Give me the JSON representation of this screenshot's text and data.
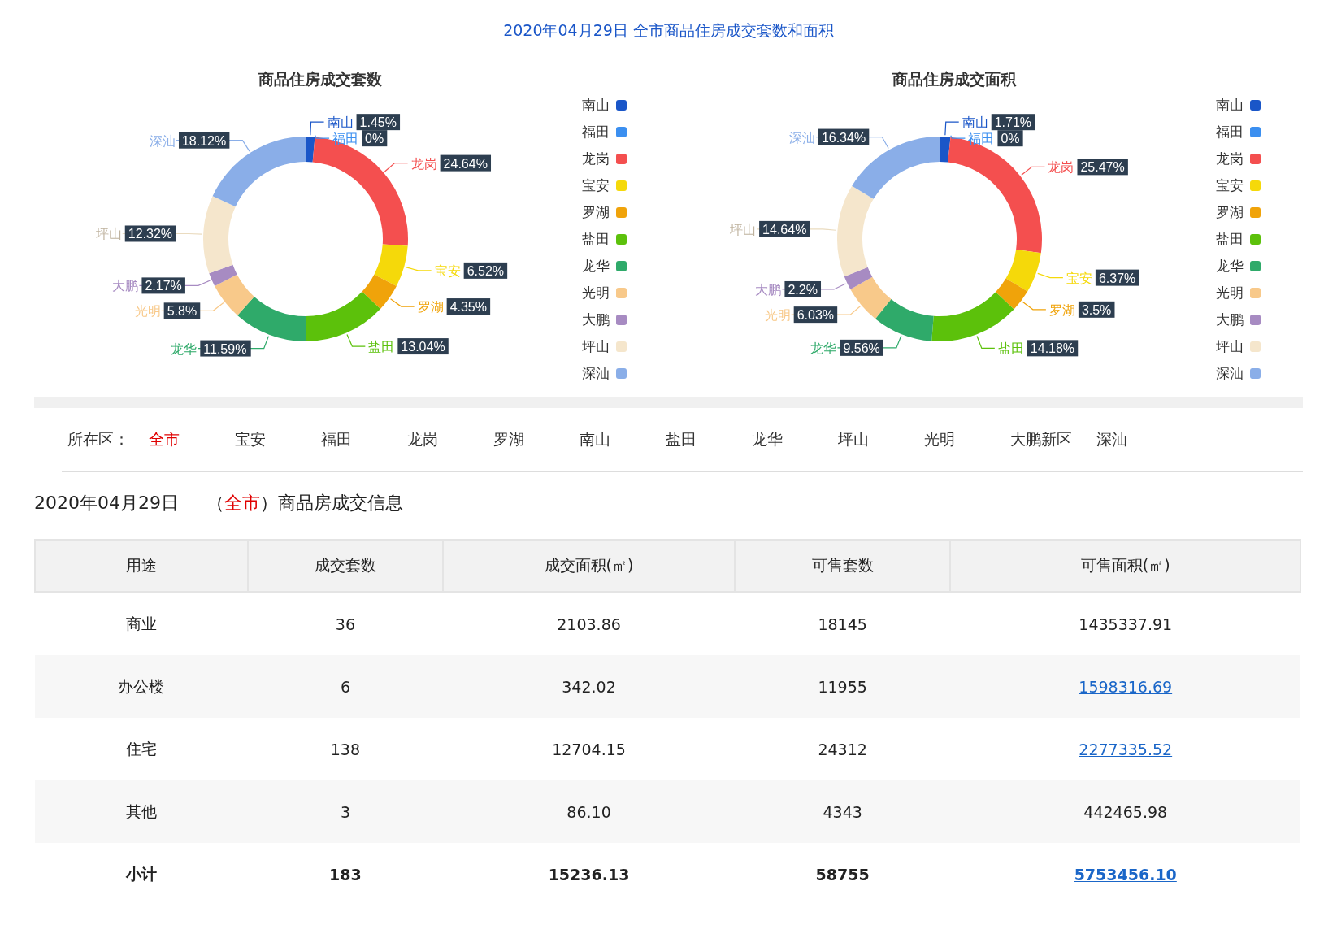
{
  "page_title": "2020年04月29日 全市商品住房成交套数和面积",
  "charts": [
    {
      "chart_data": {
        "type": "donut",
        "title": "商品住房成交套数",
        "categories": [
          "南山",
          "福田",
          "龙岗",
          "宝安",
          "罗湖",
          "盐田",
          "龙华",
          "光明",
          "大鹏",
          "坪山",
          "深汕"
        ],
        "series": [
          {
            "colors": [
              "#1a56c8",
              "#3b8ff0",
              "#f44f4f",
              "#f5d90a",
              "#f0a30a",
              "#5cc10b",
              "#2faa6a",
              "#f8c98a",
              "#a78bc2",
              "#f5e6cc",
              "#8aaee8"
            ],
            "values": [
              1.45,
              0,
              24.64,
              6.52,
              4.35,
              13.04,
              11.59,
              5.8,
              2.17,
              12.32,
              18.12
            ]
          }
        ],
        "value_labels": [
          "1.45%",
          "0%",
          "24.64%",
          "6.52%",
          "4.35%",
          "13.04%",
          "11.59%",
          "5.8%",
          "2.17%",
          "12.32%",
          "18.12%"
        ]
      },
      "legend": [
        "南山",
        "福田",
        "龙岗",
        "宝安",
        "罗湖",
        "盐田",
        "龙华",
        "光明",
        "大鹏",
        "坪山",
        "深汕"
      ]
    },
    {
      "chart_data": {
        "type": "donut",
        "title": "商品住房成交面积",
        "categories": [
          "南山",
          "福田",
          "龙岗",
          "宝安",
          "罗湖",
          "盐田",
          "龙华",
          "光明",
          "大鹏",
          "坪山",
          "深汕"
        ],
        "series": [
          {
            "colors": [
              "#1a56c8",
              "#3b8ff0",
              "#f44f4f",
              "#f5d90a",
              "#f0a30a",
              "#5cc10b",
              "#2faa6a",
              "#f8c98a",
              "#a78bc2",
              "#f5e6cc",
              "#8aaee8"
            ],
            "values": [
              1.71,
              0,
              25.47,
              6.37,
              3.5,
              14.18,
              9.56,
              6.03,
              2.2,
              14.64,
              16.34
            ]
          }
        ],
        "value_labels": [
          "1.71%",
          "0%",
          "25.47%",
          "6.37%",
          "3.5%",
          "14.18%",
          "9.56%",
          "6.03%",
          "2.2%",
          "14.64%",
          "16.34%"
        ]
      },
      "legend": [
        "南山",
        "福田",
        "龙岗",
        "宝安",
        "罗湖",
        "盐田",
        "龙华",
        "光明",
        "大鹏",
        "坪山",
        "深汕"
      ]
    }
  ],
  "filter": {
    "label": "所在区：",
    "districts": [
      {
        "label": "全市",
        "selected": true
      },
      {
        "label": "宝安",
        "selected": false
      },
      {
        "label": "福田",
        "selected": false
      },
      {
        "label": "龙岗",
        "selected": false
      },
      {
        "label": "罗湖",
        "selected": false
      },
      {
        "label": "南山",
        "selected": false
      },
      {
        "label": "盐田",
        "selected": false
      },
      {
        "label": "龙华",
        "selected": false
      },
      {
        "label": "坪山",
        "selected": false
      },
      {
        "label": "光明",
        "selected": false
      },
      {
        "label": "大鹏新区",
        "selected": false
      },
      {
        "label": "深汕",
        "selected": false
      }
    ]
  },
  "section_heading": {
    "date": "2020年04月29日",
    "open": "（",
    "district": "全市",
    "tail": "）商品房成交信息"
  },
  "table": {
    "columns": [
      "用途",
      "成交套数",
      "成交面积(㎡)",
      "可售套数",
      "可售面积(㎡)"
    ],
    "rows": [
      {
        "kind": "normal",
        "cells": [
          {
            "text": "商业",
            "link": false
          },
          {
            "text": "36",
            "link": false
          },
          {
            "text": "2103.86",
            "link": false
          },
          {
            "text": "18145",
            "link": false
          },
          {
            "text": "1435337.91",
            "link": false
          }
        ]
      },
      {
        "kind": "normal",
        "cells": [
          {
            "text": "办公楼",
            "link": false
          },
          {
            "text": "6",
            "link": false
          },
          {
            "text": "342.02",
            "link": false
          },
          {
            "text": "11955",
            "link": false
          },
          {
            "text": "1598316.69",
            "link": true
          }
        ]
      },
      {
        "kind": "normal",
        "cells": [
          {
            "text": "住宅",
            "link": false
          },
          {
            "text": "138",
            "link": false
          },
          {
            "text": "12704.15",
            "link": false
          },
          {
            "text": "24312",
            "link": false
          },
          {
            "text": "2277335.52",
            "link": true
          }
        ]
      },
      {
        "kind": "normal",
        "cells": [
          {
            "text": "其他",
            "link": false
          },
          {
            "text": "3",
            "link": false
          },
          {
            "text": "86.10",
            "link": false
          },
          {
            "text": "4343",
            "link": false
          },
          {
            "text": "442465.98",
            "link": false
          }
        ]
      },
      {
        "kind": "total",
        "cells": [
          {
            "text": "小计",
            "link": false
          },
          {
            "text": "183",
            "link": false
          },
          {
            "text": "15236.13",
            "link": false
          },
          {
            "text": "58755",
            "link": false
          },
          {
            "text": "5753456.10",
            "link": true
          }
        ]
      }
    ]
  }
}
